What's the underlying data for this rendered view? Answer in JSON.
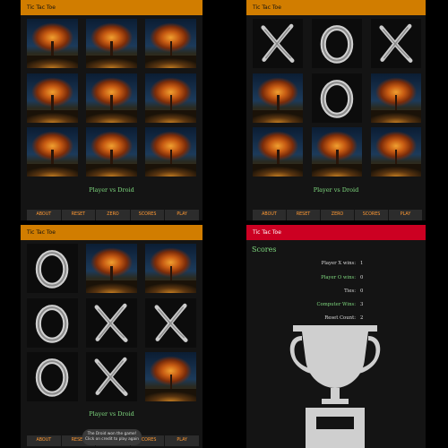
{
  "app": {
    "title": "Tic Tac Toe"
  },
  "colors": {
    "appbar": "#d17d00",
    "scores_appbar": "#cc0022",
    "accent_text": "#7fd97f",
    "button_text": "#ff9933"
  },
  "bottom_nav": [
    "ABOUT",
    "RESET",
    "ZERO",
    "SCORES",
    "PLAY"
  ],
  "screens": [
    {
      "status": "Player vs Droid",
      "board": [
        "tree",
        "tree",
        "tree",
        "tree",
        "tree",
        "tree",
        "tree",
        "tree",
        "tree"
      ]
    },
    {
      "status": "Player vs Droid",
      "board": [
        "X",
        "O",
        "X",
        "tree",
        "O",
        "tree",
        "tree",
        "tree",
        "tree"
      ]
    },
    {
      "status": "Player vs Droid",
      "board": [
        "O",
        "tree",
        "tree",
        "O",
        "X",
        "X",
        "O",
        "X",
        "tree"
      ],
      "toast": {
        "line1": "The Droid won the game!",
        "line2": "Click on credit to play again"
      }
    }
  ],
  "scores": {
    "title": "Scores",
    "rows": [
      {
        "label": "Player X wins:",
        "value": "1",
        "color": "white"
      },
      {
        "label": "Player O wins:",
        "value": "0",
        "color": "green"
      },
      {
        "label": "Ties:",
        "value": "0",
        "color": "white"
      },
      {
        "label": "Computer Wins:",
        "value": "3",
        "color": "green"
      },
      {
        "label": "Reset Count:",
        "value": "2",
        "color": "white"
      }
    ],
    "trophy_icon": "trophy-icon"
  }
}
